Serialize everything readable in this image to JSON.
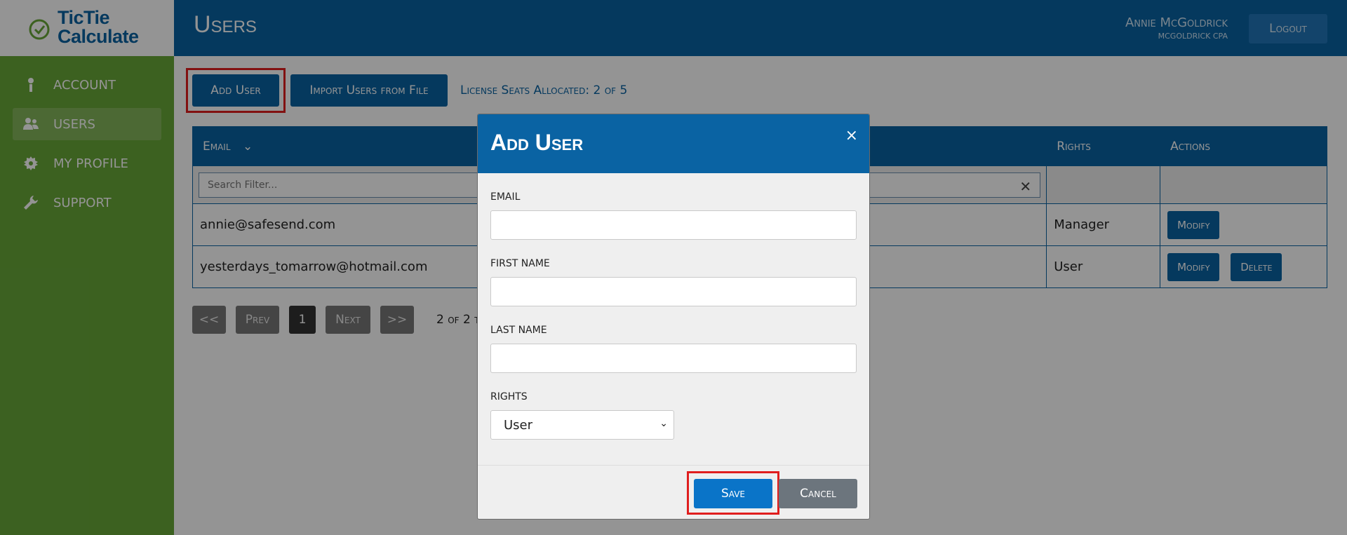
{
  "app": {
    "logo_line1": "TicTie",
    "logo_line2": "Calculate"
  },
  "sidebar": {
    "items": [
      {
        "label": "ACCOUNT",
        "icon": "account-icon"
      },
      {
        "label": "USERS",
        "icon": "users-icon",
        "active": true
      },
      {
        "label": "MY PROFILE",
        "icon": "gear-icon"
      },
      {
        "label": "SUPPORT",
        "icon": "wrench-icon"
      }
    ]
  },
  "header": {
    "title": "Users",
    "user_name": "Annie McGoldrick",
    "user_firm": "MCGOLDRICK CPA",
    "logout_label": "Logout"
  },
  "toolbar": {
    "add_user_label": "Add User",
    "import_label": "Import Users from File",
    "license_text": "License Seats Allocated: 2 of 5"
  },
  "table": {
    "columns": [
      "Email",
      "Rights",
      "Actions"
    ],
    "filter_placeholder": "Search Filter...",
    "rows": [
      {
        "email": "annie@safesend.com",
        "rights": "Manager",
        "actions": [
          "Modify"
        ]
      },
      {
        "email": "yesterdays_tomarrow@hotmail.com",
        "rights": "User",
        "actions": [
          "Modify",
          "Delete"
        ]
      }
    ]
  },
  "pager": {
    "first": "<<",
    "prev": "Prev",
    "current": "1",
    "next": "Next",
    "last": ">>",
    "info": "2 of 2 t"
  },
  "modal": {
    "title": "Add User",
    "close": "×",
    "email_label": "EMAIL",
    "email_value": "",
    "first_name_label": "FIRST NAME",
    "first_name_value": "",
    "last_name_label": "LAST NAME",
    "last_name_value": "",
    "rights_label": "RIGHTS",
    "rights_value": "User",
    "save_label": "Save",
    "cancel_label": "Cancel"
  },
  "colors": {
    "brand_blue": "#0a63a3",
    "sidebar_green": "#68a738",
    "highlight_red": "#e01e1e"
  }
}
